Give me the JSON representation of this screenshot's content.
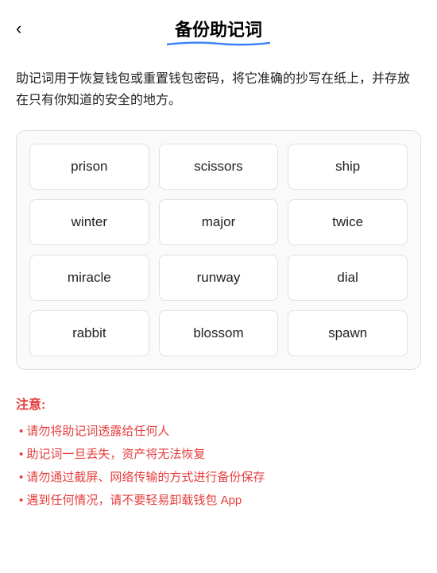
{
  "header": {
    "back_label": "‹",
    "title": "备份助记词"
  },
  "description": "助记词用于恢复钱包或重置钱包密码，将它准确的抄写在纸上，并存放在只有你知道的安全的地方。",
  "mnemonic": {
    "words": [
      "prison",
      "scissors",
      "ship",
      "winter",
      "major",
      "twice",
      "miracle",
      "runway",
      "dial",
      "rabbit",
      "blossom",
      "spawn"
    ]
  },
  "warning": {
    "title": "注意:",
    "items": [
      "• 请勿将助记词透露给任何人",
      "• 助记词一旦丢失，资产将无法恢复",
      "• 请勿通过截屏、网络传输的方式进行备份保存",
      "• 遇到任何情况，请不要轻易卸载钱包 App"
    ]
  }
}
